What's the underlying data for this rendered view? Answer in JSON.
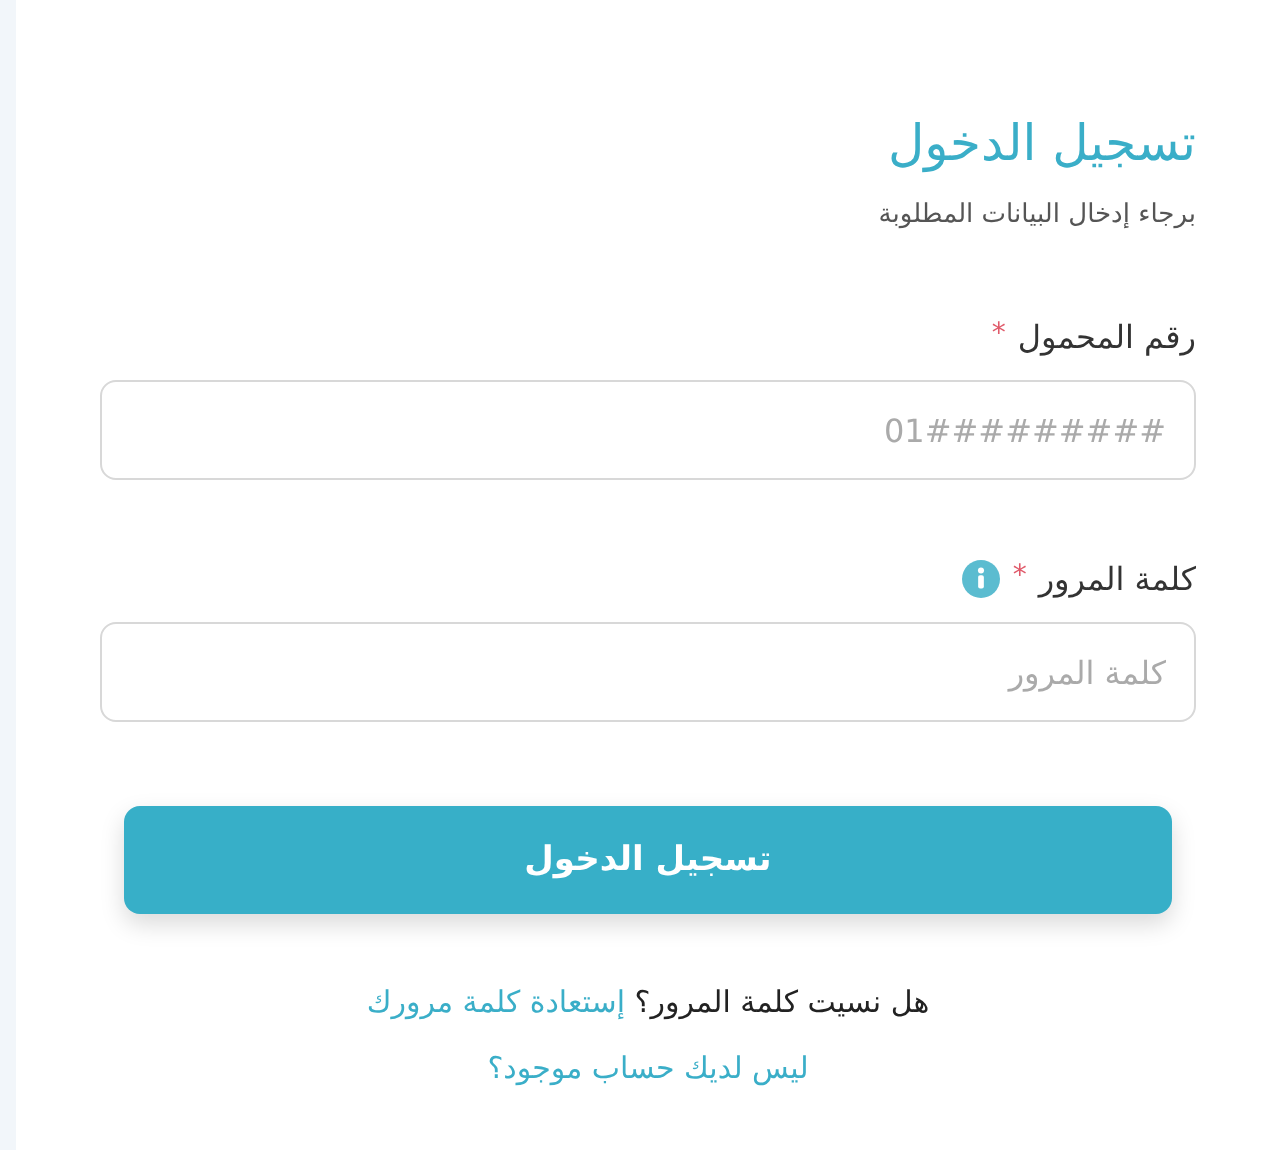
{
  "title": "تسجيل الدخول",
  "subtitle": "برجاء إدخال البيانات المطلوبة",
  "required_mark": "*",
  "fields": [
    {
      "label": "رقم المحمول",
      "required": true,
      "info": false,
      "placeholder": "01#########"
    },
    {
      "label": "كلمة المرور",
      "required": true,
      "info": true,
      "placeholder": "كلمة المرور"
    }
  ],
  "submit": "تسجيل الدخول",
  "forgot": {
    "question": "هل نسيت كلمة المرور؟",
    "link": "إستعادة كلمة مرورك"
  },
  "register_link": "ليس لديك حساب موجود؟"
}
